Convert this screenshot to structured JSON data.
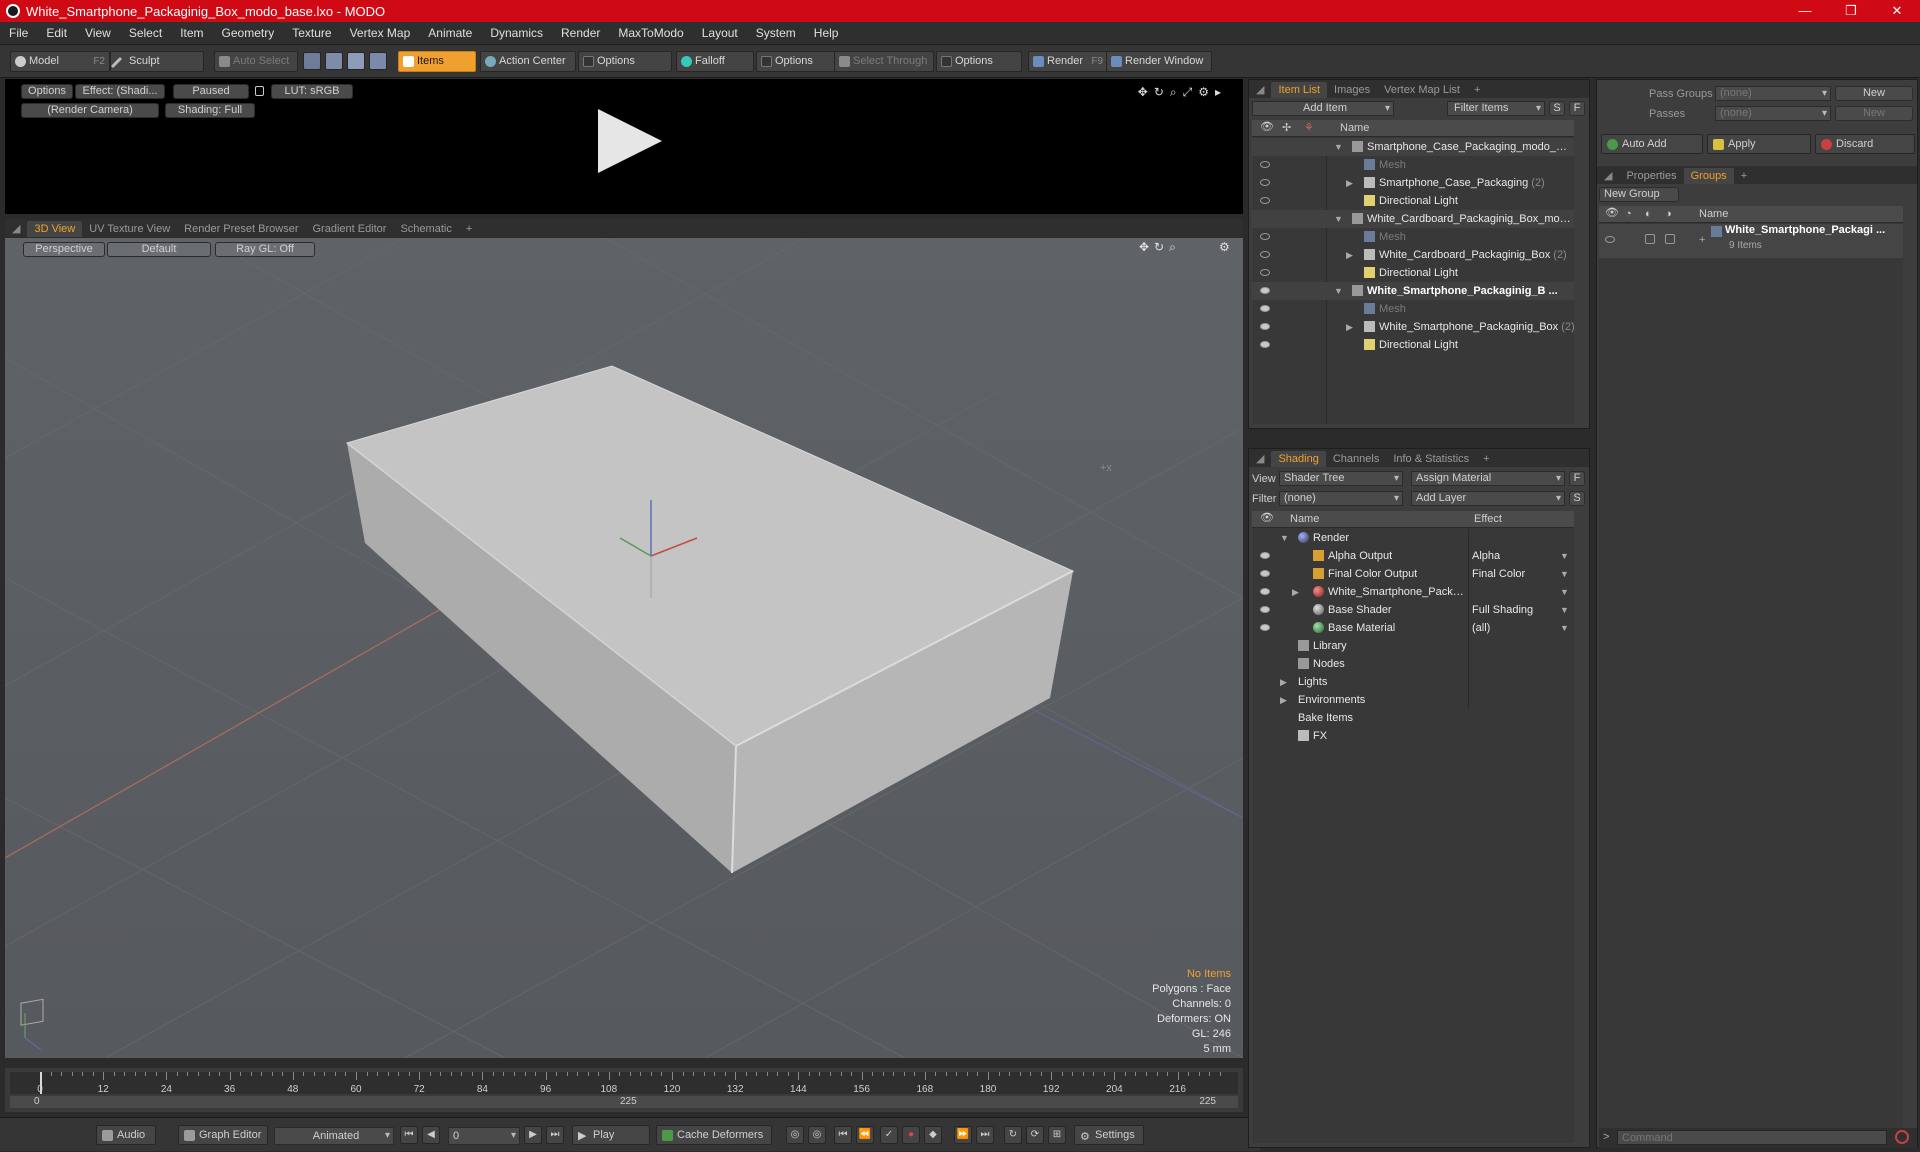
{
  "window": {
    "title": "White_Smartphone_Packaginig_Box_modo_base.lxo - MODO",
    "minimize": "—",
    "maximize": "❐",
    "close": "✕"
  },
  "menu": [
    "File",
    "Edit",
    "View",
    "Select",
    "Item",
    "Geometry",
    "Texture",
    "Vertex Map",
    "Animate",
    "Dynamics",
    "Render",
    "MaxToModo",
    "Layout",
    "System",
    "Help"
  ],
  "toolbar": {
    "model": "Model",
    "model_key": "F2",
    "sculpt": "Sculpt",
    "auto_select": "Auto Select",
    "items": "Items",
    "action_center": "Action Center",
    "options1": "Options",
    "falloff": "Falloff",
    "options2": "Options",
    "select_through": "Select Through",
    "options3": "Options",
    "render": "Render",
    "render_key": "F9",
    "render_window": "Render Window"
  },
  "preview": {
    "options": "Options",
    "effect": "Effect: (Shadi...",
    "paused": "Paused",
    "lut": "LUT: sRGB",
    "camera": "(Render Camera)",
    "shading": "Shading: Full"
  },
  "viewtabs": [
    "3D View",
    "UV Texture View",
    "Render Preset Browser",
    "Gradient Editor",
    "Schematic"
  ],
  "viewport": {
    "perspective": "Perspective",
    "default": "Default",
    "raygl": "Ray GL: Off",
    "info": {
      "no_items": "No Items",
      "polygons": "Polygons : Face",
      "channels": "Channels: 0",
      "deformers": "Deformers: ON",
      "gl": "GL: 246",
      "unit": "5 mm"
    }
  },
  "timeline": {
    "ticks": [
      "0",
      "12",
      "24",
      "36",
      "48",
      "60",
      "72",
      "84",
      "96",
      "108",
      "120",
      "132",
      "144",
      "156",
      "168",
      "180",
      "192",
      "204",
      "216"
    ],
    "start": "0",
    "mid": "225",
    "end": "225"
  },
  "transport": {
    "audio": "Audio",
    "graph_editor": "Graph Editor",
    "animated": "Animated",
    "frame": "0",
    "play": "Play",
    "cache": "Cache Deformers",
    "settings": "Settings"
  },
  "itemlist": {
    "tabs": [
      "Item List",
      "Images",
      "Vertex Map List"
    ],
    "add_item": "Add Item",
    "filter": "Filter Items",
    "s": "S",
    "f": "F",
    "col_name": "Name",
    "rows": [
      {
        "label": "Smartphone_Case_Packaging_modo_ba ...",
        "count": ""
      },
      {
        "label": "Mesh",
        "count": ""
      },
      {
        "label": "Smartphone_Case_Packaging",
        "count": "(2)"
      },
      {
        "label": "Directional Light",
        "count": ""
      },
      {
        "label": "White_Cardboard_Packaginig_Box_mod ...",
        "count": ""
      },
      {
        "label": "Mesh",
        "count": ""
      },
      {
        "label": "White_Cardboard_Packaginig_Box",
        "count": "(2)"
      },
      {
        "label": "Directional Light",
        "count": ""
      },
      {
        "label": "White_Smartphone_Packaginig_B ...",
        "count": ""
      },
      {
        "label": "Mesh",
        "count": ""
      },
      {
        "label": "White_Smartphone_Packaginig_Box",
        "count": "(2)"
      },
      {
        "label": "Directional Light",
        "count": ""
      }
    ]
  },
  "shading": {
    "tabs": [
      "Shading",
      "Channels",
      "Info & Statistics"
    ],
    "view_label": "View",
    "view_value": "Shader Tree",
    "assign_material": "Assign Material",
    "filter_label": "Filter",
    "filter_value": "(none)",
    "add_layer": "Add Layer",
    "f": "F",
    "s": "S",
    "col_name": "Name",
    "col_effect": "Effect",
    "rows": [
      {
        "label": "Render",
        "effect": ""
      },
      {
        "label": "Alpha Output",
        "effect": "Alpha"
      },
      {
        "label": "Final Color Output",
        "effect": "Final Color"
      },
      {
        "label": "White_Smartphone_Packa ...",
        "effect": ""
      },
      {
        "label": "Base Shader",
        "effect": "Full Shading"
      },
      {
        "label": "Base Material",
        "effect": "(all)"
      },
      {
        "label": "Library",
        "effect": ""
      },
      {
        "label": "Nodes",
        "effect": ""
      },
      {
        "label": "Lights",
        "effect": ""
      },
      {
        "label": "Environments",
        "effect": ""
      },
      {
        "label": "Bake Items",
        "effect": ""
      },
      {
        "label": "FX",
        "effect": ""
      }
    ]
  },
  "groups": {
    "pass_groups": "Pass Groups",
    "pass_groups_value": "(none)",
    "new": "New",
    "passes": "Passes",
    "passes_value": "(none)",
    "new2": "New",
    "auto_add": "Auto Add",
    "apply": "Apply",
    "discard": "Discard",
    "tabs": [
      "Properties",
      "Groups"
    ],
    "new_group": "New Group",
    "col_name": "Name",
    "group_name": "White_Smartphone_Packagi ...",
    "group_count": "9 Items"
  },
  "command": {
    "placeholder": "Command"
  },
  "colors": {
    "accent": "#f0a02e",
    "title": "#cf0a15"
  }
}
